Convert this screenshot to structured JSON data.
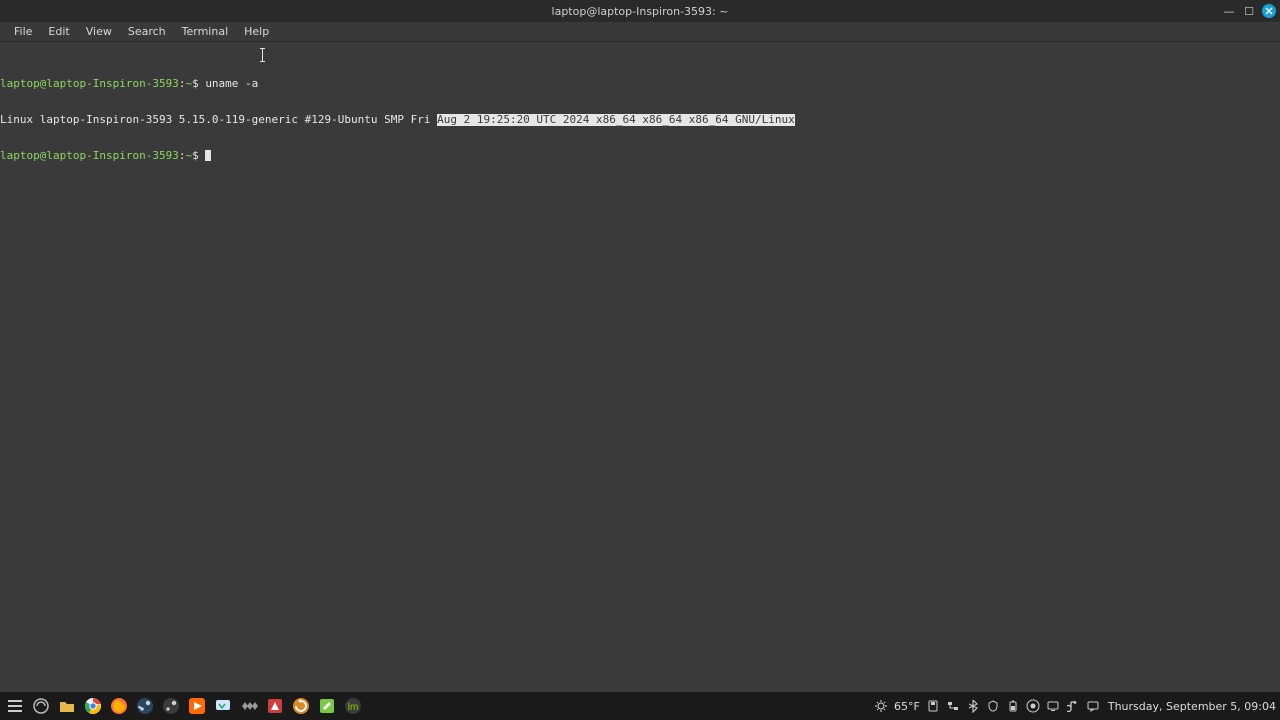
{
  "window": {
    "title": "laptop@laptop-Inspiron-3593: ~"
  },
  "menubar": {
    "items": [
      "File",
      "Edit",
      "View",
      "Search",
      "Terminal",
      "Help"
    ]
  },
  "terminal": {
    "prompt_userhost": "laptop@laptop-Inspiron-3593",
    "prompt_path": "~",
    "prompt_sep": ":",
    "prompt_dollar": "$ ",
    "line1_command": "uname -a",
    "line2_output_plain": "Linux laptop-Inspiron-3593 5.15.0-119-generic #129-Ubuntu SMP Fri ",
    "line2_output_selected": "Aug 2 19:25:20 UTC 2024 x86_64 x86_64 x86_64 GNU/Linux"
  },
  "taskbar": {
    "apps": [
      {
        "name": "menu",
        "color": "#9a9a9a"
      },
      {
        "name": "show-desktop",
        "color": "#9a9a9a"
      },
      {
        "name": "files",
        "color": "#e8b84a"
      },
      {
        "name": "chrome",
        "color": "#ffffff"
      },
      {
        "name": "firefox",
        "color": "#ff7139"
      },
      {
        "name": "steam",
        "color": "#b9b9b9"
      },
      {
        "name": "steam-alt",
        "color": "#b9b9b9"
      },
      {
        "name": "media-player",
        "color": "#ff6a00"
      },
      {
        "name": "vnc",
        "color": "#cfe8ff"
      },
      {
        "name": "obs-alt",
        "color": "#b9b9b9"
      },
      {
        "name": "adblock",
        "color": "#d23b3b"
      },
      {
        "name": "update-manager",
        "color": "#d88b28"
      },
      {
        "name": "pinned-app",
        "color": "#7ac943"
      },
      {
        "name": "mint-menu",
        "color": "#b9b9b9"
      }
    ],
    "weather": "65°F",
    "tray_icons": [
      "removable-media",
      "wired-network",
      "bluetooth",
      "security",
      "power",
      "screen",
      "sound",
      "notifications"
    ],
    "clock": "Thursday, September 5, 09:04"
  }
}
